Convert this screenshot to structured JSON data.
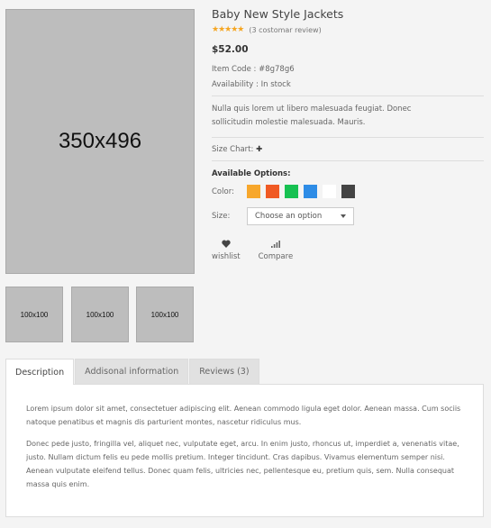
{
  "gallery": {
    "main_label": "350x496",
    "thumbs": [
      "100x100",
      "100x100",
      "100x100"
    ]
  },
  "product": {
    "title": "Baby New Style Jackets",
    "stars": "★★★★★",
    "rating": 5,
    "review_text": "(3 costomar review)",
    "price": "$52.00",
    "item_code": "Item Code : #8g78g6",
    "availability": "Availability : In stock",
    "description": "Nulla quis lorem ut libero malesuada feugiat. Donec sollicitudin molestie malesuada. Mauris.",
    "size_chart_label": "Size Chart:",
    "options_title": "Available Options:",
    "color_label": "Color:",
    "colors": [
      "#f7a72c",
      "#f05a24",
      "#17c152",
      "#2e8ce6",
      "#ffffff",
      "#444444"
    ],
    "size_label": "Size:",
    "size_placeholder": "Choose an option",
    "wishlist_label": "wishlist",
    "compare_label": "Compare"
  },
  "tabs": [
    {
      "label": "Description",
      "active": true
    },
    {
      "label": "Addisonal information",
      "active": false
    },
    {
      "label": "Reviews (3)",
      "active": false
    }
  ],
  "panel": {
    "para1": "Lorem ipsum dolor sit amet, consectetuer adipiscing elit. Aenean commodo ligula eget dolor. Aenean massa. Cum sociis natoque penatibus et magnis dis parturient montes, nascetur ridiculus mus.",
    "para2": "Donec pede justo, fringilla vel, aliquet nec, vulputate eget, arcu. In enim justo, rhoncus ut, imperdiet a, venenatis vitae, justo. Nullam dictum felis eu pede mollis pretium. Integer tincidunt. Cras dapibus. Vivamus elementum semper nisi. Aenean vulputate eleifend tellus. Donec quam felis, ultricies nec, pellentesque eu, pretium quis, sem. Nulla consequat massa quis enim."
  }
}
